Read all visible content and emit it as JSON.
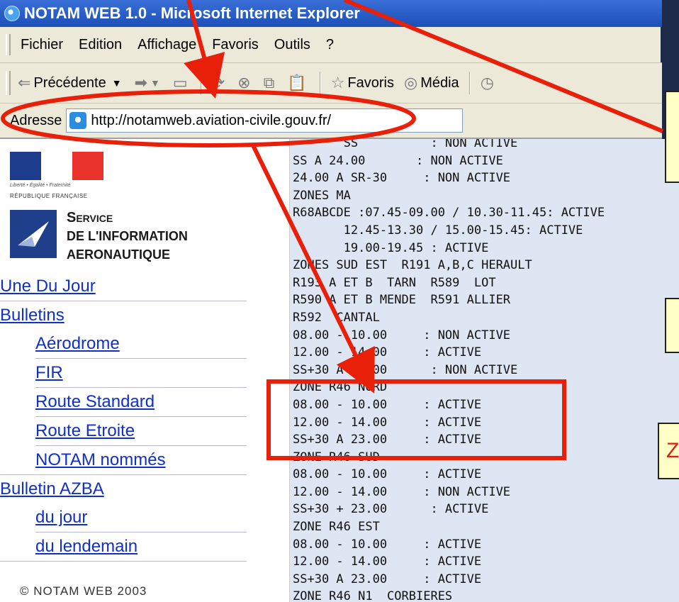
{
  "window": {
    "title": "NOTAM WEB 1.0 - Microsoft Internet Explorer"
  },
  "menu": [
    "Fichier",
    "Edition",
    "Affichage",
    "Favoris",
    "Outils",
    "?"
  ],
  "toolbar": {
    "back_label": "Précédente",
    "favorites_label": "Favoris",
    "media_label": "Média"
  },
  "address": {
    "label": "Adresse",
    "url": "http://notamweb.aviation-civile.gouv.fr/"
  },
  "sidebar": {
    "motto": "Liberté • Égalité • Fraternité",
    "republique": "RÉPUBLIQUE FRANÇAISE",
    "org_line1": "Service",
    "org_line2": "DE L'INFORMATION",
    "org_line3": "AERONAUTIQUE",
    "nav": [
      {
        "label": "Une Du Jour",
        "level": 0
      },
      {
        "label": "Bulletins",
        "level": 0
      },
      {
        "label": "Aérodrome",
        "level": 1
      },
      {
        "label": "FIR",
        "level": 1
      },
      {
        "label": "Route Standard",
        "level": 1
      },
      {
        "label": "Route Etroite",
        "level": 1
      },
      {
        "label": "NOTAM nommés",
        "level": 1
      },
      {
        "label": "Bulletin AZBA",
        "level": 0
      },
      {
        "label": "du jour",
        "level": 1
      },
      {
        "label": "du lendemain",
        "level": 1
      }
    ],
    "copyright": "© NOTAM WEB 2003"
  },
  "bulletin_lines": [
    "       SS          : NON ACTIVE",
    "SS A 24.00       : NON ACTIVE",
    "24.00 A SR-30     : NON ACTIVE",
    "ZONES MA",
    "R68ABCDE :07.45-09.00 / 10.30-11.45: ACTIVE",
    "       12.45-13.30 / 15.00-15.45: ACTIVE",
    "       19.00-19.45 : ACTIVE",
    "ZONES SUD EST  R191 A,B,C HERAULT",
    "R193 A ET B  TARN  R589  LOT",
    "R590 A ET B MENDE  R591 ALLIER",
    "R592  CANTAL",
    "08.00 - 10.00     : NON ACTIVE",
    "12.00 - 14.00     : ACTIVE",
    "SS+30 A 23.00      : NON ACTIVE",
    "ZONE R46 NORD",
    "08.00 - 10.00     : ACTIVE",
    "12.00 - 14.00     : ACTIVE",
    "SS+30 A 23.00     : ACTIVE",
    "ZONE R46 SUD",
    "08.00 - 10.00     : ACTIVE",
    "12.00 - 14.00     : NON ACTIVE",
    "SS+30 + 23.00      : ACTIVE",
    "ZONE R46 EST",
    "08.00 - 10.00     : ACTIVE",
    "12.00 - 14.00     : ACTIVE",
    "SS+30 A 23.00     : ACTIVE",
    "ZONE R46 N1  CORBIERES"
  ],
  "callout_fragment": "Z",
  "colors": {
    "annotation_red": "#e8200a",
    "callout_bg": "#ffffc8",
    "link_blue": "#1030c8"
  }
}
